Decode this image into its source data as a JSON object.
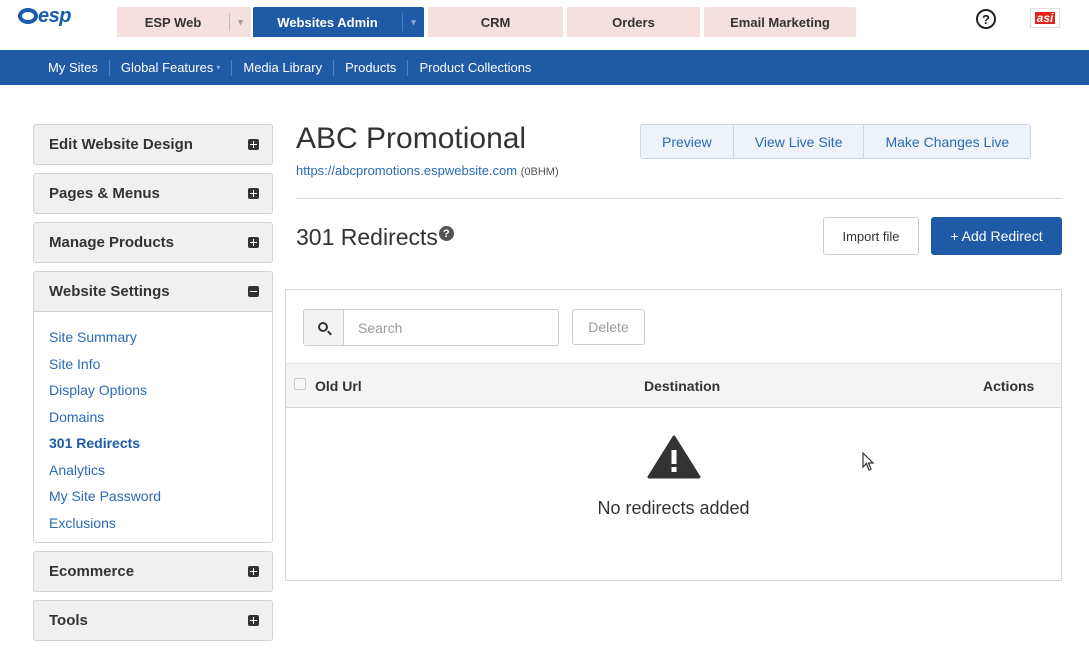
{
  "header": {
    "logo_text": "esp",
    "tabs": [
      {
        "label": "ESP Web",
        "caret": "▾"
      },
      {
        "label": "Websites Admin",
        "caret": "▾"
      },
      {
        "label": "CRM"
      },
      {
        "label": "Orders"
      },
      {
        "label": "Email Marketing"
      }
    ],
    "help_glyph": "?",
    "brand_logo_text": "asi"
  },
  "subnav": {
    "items": [
      "My Sites",
      "Global Features",
      "Media Library",
      "Products",
      "Product Collections"
    ],
    "caret": "▾"
  },
  "sidebar": {
    "panels": [
      {
        "label": "Edit Website Design",
        "state": "collapsed"
      },
      {
        "label": "Pages & Menus",
        "state": "collapsed"
      },
      {
        "label": "Manage Products",
        "state": "collapsed"
      },
      {
        "label": "Website Settings",
        "state": "expanded"
      },
      {
        "label": "Ecommerce",
        "state": "collapsed"
      },
      {
        "label": "Tools",
        "state": "collapsed"
      }
    ],
    "settings_links": [
      "Site Summary",
      "Site Info",
      "Display Options",
      "Domains",
      "301 Redirects",
      "Analytics",
      "My Site Password",
      "Exclusions"
    ],
    "active_link": "301 Redirects"
  },
  "site": {
    "title": "ABC Promotional",
    "url": "https://abcpromotions.espwebsite.com",
    "code": "(0BHM)"
  },
  "actions": {
    "preview": "Preview",
    "view_live": "View Live Site",
    "make_live": "Make Changes Live"
  },
  "section": {
    "title": "301 Redirects",
    "help_glyph": "?",
    "import_label": "Import file",
    "add_label": "+ Add Redirect"
  },
  "table": {
    "search_placeholder": "Search",
    "delete_label": "Delete",
    "columns": [
      "Old Url",
      "Destination",
      "Actions"
    ],
    "empty_message": "No redirects added"
  },
  "colors": {
    "brand_blue": "#1f5aa6",
    "tab_pink": "#f6dfdf",
    "link_blue": "#2a6ab5"
  }
}
